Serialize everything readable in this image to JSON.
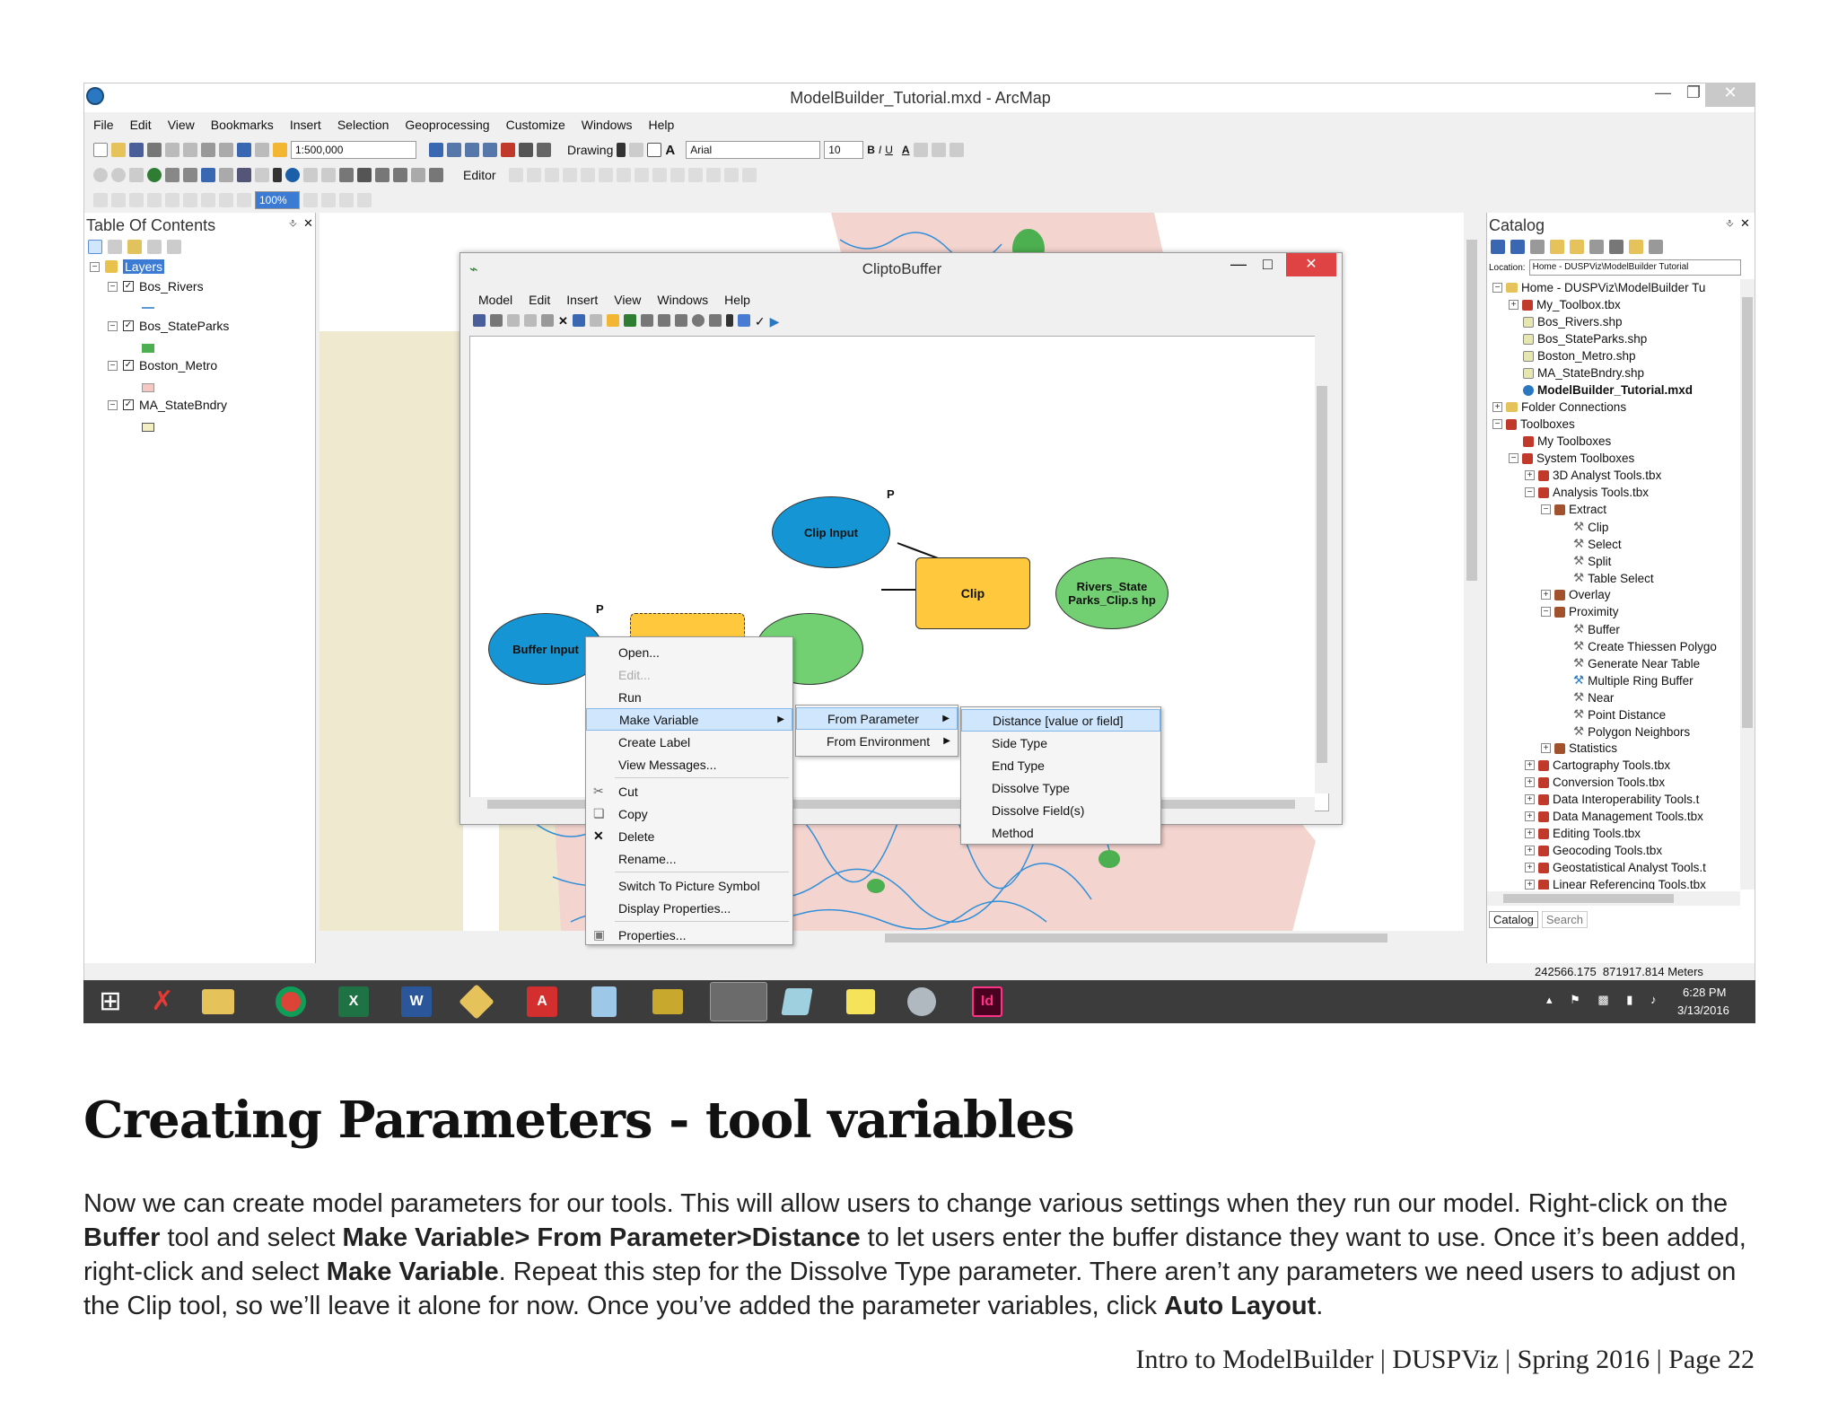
{
  "window": {
    "title": "ModelBuilder_Tutorial.mxd - ArcMap",
    "menu": [
      "File",
      "Edit",
      "View",
      "Bookmarks",
      "Insert",
      "Selection",
      "Geoprocessing",
      "Customize",
      "Windows",
      "Help"
    ],
    "scale": "1:500,000",
    "drawing_label": "Drawing",
    "font_name": "Arial",
    "font_size": "10",
    "editor_label": "Editor",
    "zoom_value": "100%"
  },
  "toc": {
    "title": "Table Of Contents",
    "layers_label": "Layers",
    "layers": [
      {
        "name": "Bos_Rivers",
        "swatch": "#5b9bd5"
      },
      {
        "name": "Bos_StateParks",
        "swatch": "#4caf50"
      },
      {
        "name": "Boston_Metro",
        "swatch": "#f4c7c3"
      },
      {
        "name": "MA_StateBndry",
        "swatch": "#f3efc2"
      }
    ]
  },
  "modelbuilder": {
    "title": "CliptoBuffer",
    "menu": [
      "Model",
      "Edit",
      "Insert",
      "View",
      "Windows",
      "Help"
    ],
    "nodes": {
      "clip_input": "Clip Input",
      "buffer_input": "Buffer Input",
      "clip": "Clip",
      "output": "Rivers_State Parks_Clip.s hp",
      "p1": "P",
      "p2": "P"
    }
  },
  "context_menu": {
    "items": [
      "Open...",
      "Edit...",
      "Run",
      "Make Variable",
      "Create Label",
      "View Messages...",
      "Cut",
      "Copy",
      "Delete",
      "Rename...",
      "Switch To Picture Symbol",
      "Display Properties...",
      "Properties..."
    ],
    "sub1": [
      "From Parameter",
      "From Environment"
    ],
    "sub2": [
      "Distance [value or field]",
      "Side Type",
      "End Type",
      "Dissolve Type",
      "Dissolve Field(s)",
      "Method"
    ]
  },
  "catalog": {
    "title": "Catalog",
    "location_label": "Location:",
    "location_value": "Home - DUSPViz\\ModelBuilder Tutorial",
    "items": [
      "Home - DUSPViz\\ModelBuilder Tu",
      "My_Toolbox.tbx",
      "Bos_Rivers.shp",
      "Bos_StateParks.shp",
      "Boston_Metro.shp",
      "MA_StateBndry.shp",
      "ModelBuilder_Tutorial.mxd",
      "Folder Connections",
      "Toolboxes",
      "My Toolboxes",
      "System Toolboxes",
      "3D Analyst Tools.tbx",
      "Analysis Tools.tbx",
      "Extract",
      "Clip",
      "Select",
      "Split",
      "Table Select",
      "Overlay",
      "Proximity",
      "Buffer",
      "Create Thiessen Polygo",
      "Generate Near Table",
      "Multiple Ring Buffer",
      "Near",
      "Point Distance",
      "Polygon Neighbors",
      "Statistics",
      "Cartography Tools.tbx",
      "Conversion Tools.tbx",
      "Data Interoperability Tools.t",
      "Data Management Tools.tbx",
      "Editing Tools.tbx",
      "Geocoding Tools.tbx",
      "Geostatistical Analyst Tools.t",
      "Linear Referencing Tools.tbx"
    ],
    "tab_catalog": "Catalog",
    "tab_search": "Search"
  },
  "status": {
    "coords": "242566.175  871917.814 Meters"
  },
  "taskbar": {
    "time": "6:28 PM",
    "date": "3/13/2016"
  },
  "doc": {
    "heading": "Creating Parameters - tool variables",
    "p1": "Now we can create model parameters for our tools. This will allow users to change various settings when they run our model. Right-click on the ",
    "b1": "Buffer",
    "p2": " tool and select ",
    "b2": "Make Variable> From Parameter>Distance",
    "p3": " to let users enter the buffer distance they want to use. Once it’s been added, right-click and select ",
    "b3": "Make Variable",
    "p4": ". Repeat this step for the Dissolve Type parameter. There aren’t any parameters we need users to adjust on the Clip tool, so we’ll leave it alone for now. Once you’ve added the parameter variables, click ",
    "b4": "Auto Layout",
    "p5": ".",
    "footer": "Intro to ModelBuilder | DUSPViz | Spring 2016 | Page 22"
  }
}
